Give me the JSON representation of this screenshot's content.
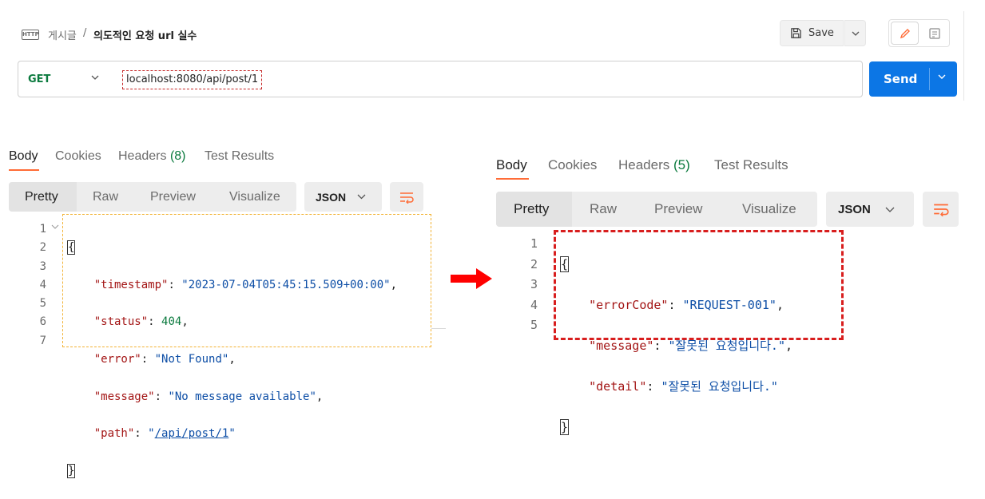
{
  "header": {
    "protocol_badge": "HTTP",
    "breadcrumb_parent": "게시글",
    "breadcrumb_separator": "/",
    "request_name": "의도적인 요청 url 실수",
    "save_label": "Save"
  },
  "request": {
    "method": "GET",
    "url": "localhost:8080/api/post/1",
    "send_label": "Send"
  },
  "left_panel": {
    "tabs": {
      "body": "Body",
      "cookies": "Cookies",
      "headers": "Headers",
      "headers_count": "(8)",
      "test_results": "Test Results"
    },
    "view_modes": {
      "pretty": "Pretty",
      "raw": "Raw",
      "preview": "Preview",
      "visualize": "Visualize"
    },
    "format": "JSON",
    "lines": [
      "1",
      "2",
      "3",
      "4",
      "5",
      "6",
      "7"
    ],
    "code": {
      "open": "{",
      "timestamp_key": "\"timestamp\"",
      "timestamp_val": "\"2023-07-04T05:45:15.509+00:00\"",
      "status_key": "\"status\"",
      "status_val": "404",
      "error_key": "\"error\"",
      "error_val": "\"Not Found\"",
      "message_key": "\"message\"",
      "message_val": "\"No message available\"",
      "path_key": "\"path\"",
      "path_q1": "\"",
      "path_val": "/api/post/1",
      "path_q2": "\"",
      "close": "}"
    }
  },
  "right_panel": {
    "tabs": {
      "body": "Body",
      "cookies": "Cookies",
      "headers": "Headers",
      "headers_count": "(5)",
      "test_results": "Test Results"
    },
    "view_modes": {
      "pretty": "Pretty",
      "raw": "Raw",
      "preview": "Preview",
      "visualize": "Visualize"
    },
    "format": "JSON",
    "lines": [
      "1",
      "2",
      "3",
      "4",
      "5"
    ],
    "code": {
      "open": "{",
      "errorCode_key": "\"errorCode\"",
      "errorCode_val": "\"REQUEST-001\"",
      "message_key": "\"message\"",
      "message_val": "\"잘못된 요청입니다.\"",
      "detail_key": "\"detail\"",
      "detail_val": "\"잘못된 요청입니다.\"",
      "close": "}"
    }
  },
  "colors": {
    "accent": "#ff6c37",
    "send": "#0c76e5",
    "method_get": "#0b7a3e",
    "json_key": "#a31515",
    "json_string": "#0d4ea6",
    "highlight_left": "#f2b233",
    "highlight_right": "#d81e1e",
    "arrow": "#ff0000"
  },
  "icons": [
    "http-icon",
    "save-icon",
    "chevron-down-icon",
    "pencil-icon",
    "document-icon",
    "wrap-lines-icon",
    "fold-chevron-icon",
    "right-arrow-icon"
  ]
}
